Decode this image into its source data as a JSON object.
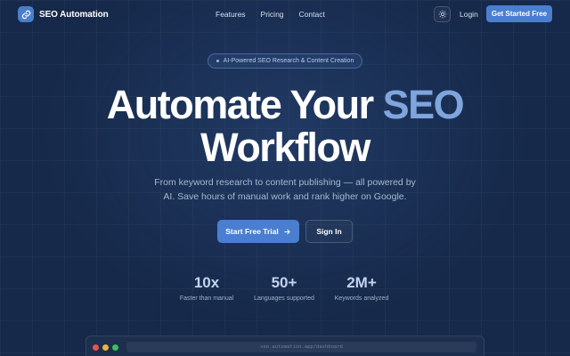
{
  "nav": {
    "logo_text": "SEO Automation",
    "logo_icon": "link-icon",
    "links": [
      {
        "label": "Features"
      },
      {
        "label": "Pricing"
      },
      {
        "label": "Contact"
      }
    ],
    "theme_icon": "sun-icon",
    "login_label": "Login",
    "cta_label": "Get Started Free"
  },
  "hero": {
    "badge_text": "AI-Powered SEO Research & Content Creation",
    "headline_part1": "Automate Your ",
    "headline_accent": "SEO",
    "headline_part2": "Workflow",
    "subtext": "From keyword research to content publishing — all powered by AI. Save hours of manual work and rank higher on Google.",
    "primary_button": "Start Free Trial",
    "primary_button_icon": "arrow-right-icon",
    "secondary_button": "Sign In"
  },
  "stats": [
    {
      "value": "10x",
      "label": "Faster than manual"
    },
    {
      "value": "50+",
      "label": "Languages supported"
    },
    {
      "value": "2M+",
      "label": "Keywords analyzed"
    }
  ],
  "preview": {
    "url": "seo.automation.app/dashboard"
  },
  "colors": {
    "background": "#16294a",
    "accent": "#4a7ed0",
    "headline_accent": "#7fa5de"
  }
}
